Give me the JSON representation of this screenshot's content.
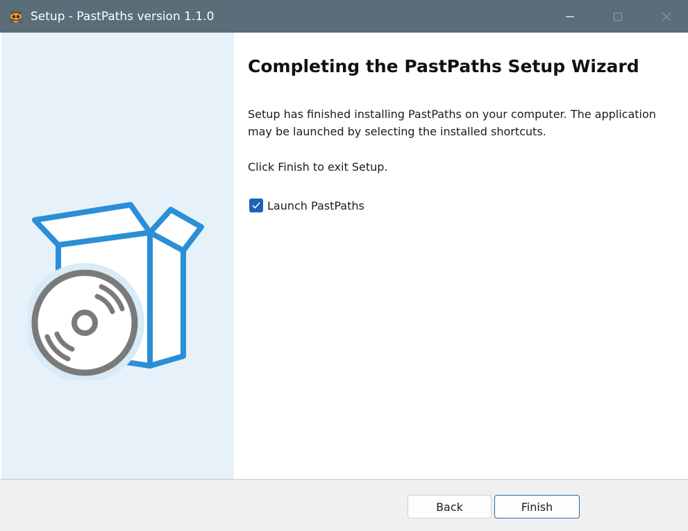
{
  "window": {
    "title": "Setup - PastPaths version 1.1.0",
    "app_icon": "pastpaths-skull-icon",
    "controls": [
      "minimize-icon",
      "maximize-icon",
      "close-icon"
    ]
  },
  "banner": {
    "art": "software-box-with-disc-icon",
    "colors": {
      "background": "#e6f1f9",
      "box": "#2a8fd6",
      "disc": "#7a7a7a"
    }
  },
  "content": {
    "heading": "Completing the PastPaths Setup Wizard",
    "body": "Setup has finished installing PastPaths on your computer. The application may be launched by selecting the installed shortcuts.",
    "finish_hint": "Click Finish to exit Setup.",
    "launch_checkbox": {
      "label": "Launch PastPaths",
      "checked": true
    }
  },
  "footer": {
    "back_label": "Back",
    "finish_label": "Finish"
  }
}
